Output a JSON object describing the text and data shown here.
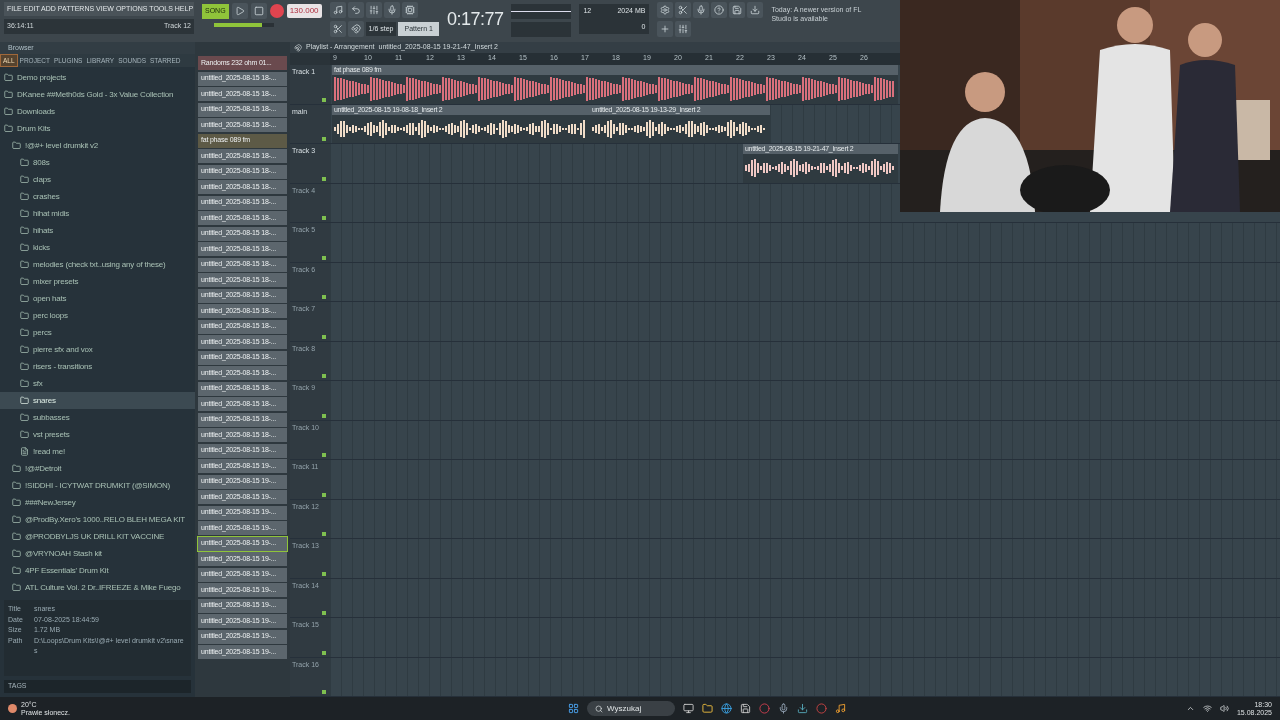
{
  "menu": "FILE EDIT ADD PATTERNS VIEW OPTIONS TOOLS HELP",
  "song_position": "36:14:11",
  "track_hint": "Track 12",
  "transport": {
    "mode": "SONG",
    "tempo": "130.000",
    "time": "0:17:77",
    "memory": "2024 MB",
    "cpu": "12",
    "polyphony": "0",
    "snap": "1/6 step",
    "pattern": "Pattern 1",
    "news": "Today: A newer version of FL Studio is available",
    "master_volume": {
      "level": 0.8
    }
  },
  "browser": {
    "title": "Browser",
    "tabs": [
      {
        "label": "ALL",
        "selected": true
      },
      {
        "label": "PROJECT",
        "selected": false
      },
      {
        "label": "PLUGINS",
        "selected": false
      },
      {
        "label": "LIBRARY",
        "selected": false
      },
      {
        "label": "SOUNDS",
        "selected": false
      },
      {
        "label": "STARRED",
        "selected": false
      }
    ],
    "tree": [
      {
        "label": "Demo projects",
        "kind": "folder",
        "selected": false
      },
      {
        "label": "DKanee ##Meth0ds Gold - 3x Value Collection",
        "kind": "folder",
        "selected": false
      },
      {
        "label": "Downloads",
        "kind": "folder",
        "selected": false
      },
      {
        "label": "Drum Kits",
        "kind": "folder",
        "selected": false,
        "children": [
          {
            "label": "!@#+ level drumkit v2",
            "kind": "folder",
            "selected": false,
            "children": [
              {
                "label": "808s",
                "kind": "folder",
                "selected": false
              },
              {
                "label": "claps",
                "kind": "folder",
                "selected": false
              },
              {
                "label": "crashes",
                "kind": "folder",
                "selected": false
              },
              {
                "label": "hihat midis",
                "kind": "folder",
                "selected": false
              },
              {
                "label": "hihats",
                "kind": "folder",
                "selected": false
              },
              {
                "label": "kicks",
                "kind": "folder",
                "selected": false
              },
              {
                "label": "melodies (check txt..using any of these)",
                "kind": "folder",
                "selected": false
              },
              {
                "label": "mixer presets",
                "kind": "folder",
                "selected": false
              },
              {
                "label": "open hats",
                "kind": "folder",
                "selected": false
              },
              {
                "label": "perc loops",
                "kind": "folder",
                "selected": false
              },
              {
                "label": "percs",
                "kind": "folder",
                "selected": false
              },
              {
                "label": "pierre sfx and vox",
                "kind": "folder",
                "selected": false
              },
              {
                "label": "risers - transitions",
                "kind": "folder",
                "selected": false
              },
              {
                "label": "sfx",
                "kind": "folder",
                "selected": false
              },
              {
                "label": "snares",
                "kind": "folder",
                "selected": true
              },
              {
                "label": "subbasses",
                "kind": "folder",
                "selected": false
              },
              {
                "label": "vst presets",
                "kind": "folder",
                "selected": false
              },
              {
                "label": "!read me!",
                "kind": "file",
                "selected": false
              }
            ]
          },
          {
            "label": "!@#Detroit",
            "kind": "folder",
            "selected": false
          },
          {
            "label": "!SIDDHI - ICYTWAT DRUMKIT (@SIMON)",
            "kind": "folder",
            "selected": false
          },
          {
            "label": "###NewJersey",
            "kind": "folder",
            "selected": false
          },
          {
            "label": "@ProdBy.Xero's 1000..RELO BLEH MEGA KIT",
            "kind": "folder",
            "selected": false
          },
          {
            "label": "@PRODBYLJS UK DRILL KIT VACCINE",
            "kind": "folder",
            "selected": false
          },
          {
            "label": "@VRYNOAH Stash kit",
            "kind": "folder",
            "selected": false
          },
          {
            "label": "4PF Essentials' Drum Kit",
            "kind": "folder",
            "selected": false
          },
          {
            "label": "ATL Culture Vol. 2 Dr..IFREEZE & Mike Fuego",
            "kind": "folder",
            "selected": false
          }
        ]
      }
    ],
    "info": [
      {
        "label": "Title",
        "value": "snares"
      },
      {
        "label": "Date",
        "value": "07-08-2025 18:44:59"
      },
      {
        "label": "Size",
        "value": "1.72 MB"
      },
      {
        "label": "Path",
        "value": "D:\\Loops\\Drum Kits\\!@#+ level drumkit v2\\snares"
      }
    ],
    "tags_label": "TAGS"
  },
  "channels": [
    {
      "label": "Randoms 232 ohm 01...",
      "selected": false,
      "color": "#6a4a4e"
    },
    {
      "label": "untitled_2025-08-15 18-...",
      "selected": false,
      "color": "#5c666d"
    },
    {
      "label": "untitled_2025-08-15 18-...",
      "selected": false,
      "color": "#5c666d"
    },
    {
      "label": "untitled_2025-08-15 18-...",
      "selected": false,
      "color": "#5c666d"
    },
    {
      "label": "untitled_2025-08-15 18-...",
      "selected": false,
      "color": "#5c666d"
    },
    {
      "label": "fat phase 089 fm",
      "selected": false,
      "color": "#5d5a46"
    },
    {
      "label": "untitled_2025-08-15 18-...",
      "selected": false,
      "color": "#5c666d"
    },
    {
      "label": "untitled_2025-08-15 18-...",
      "selected": false,
      "color": "#5c666d"
    },
    {
      "label": "untitled_2025-08-15 18-...",
      "selected": false,
      "color": "#5c666d"
    },
    {
      "label": "untitled_2025-08-15 18-...",
      "selected": false,
      "color": "#5c666d"
    },
    {
      "label": "untitled_2025-08-15 18-...",
      "selected": false,
      "color": "#5c666d"
    },
    {
      "label": "untitled_2025-08-15 18-...",
      "selected": false,
      "color": "#5c666d"
    },
    {
      "label": "untitled_2025-08-15 18-...",
      "selected": false,
      "color": "#5c666d"
    },
    {
      "label": "untitled_2025-08-15 18-...",
      "selected": false,
      "color": "#5c666d"
    },
    {
      "label": "untitled_2025-08-15 18-...",
      "selected": false,
      "color": "#5c666d"
    },
    {
      "label": "untitled_2025-08-15 18-...",
      "selected": false,
      "color": "#5c666d"
    },
    {
      "label": "untitled_2025-08-15 18-...",
      "selected": false,
      "color": "#5c666d"
    },
    {
      "label": "untitled_2025-08-15 18-...",
      "selected": false,
      "color": "#5c666d"
    },
    {
      "label": "untitled_2025-08-15 18-...",
      "selected": false,
      "color": "#5c666d"
    },
    {
      "label": "untitled_2025-08-15 18-...",
      "selected": false,
      "color": "#5c666d"
    },
    {
      "label": "untitled_2025-08-15 18-...",
      "selected": false,
      "color": "#5c666d"
    },
    {
      "label": "untitled_2025-08-15 18-...",
      "selected": false,
      "color": "#5c666d"
    },
    {
      "label": "untitled_2025-08-15 18-...",
      "selected": false,
      "color": "#5c666d"
    },
    {
      "label": "untitled_2025-08-15 18-...",
      "selected": false,
      "color": "#5c666d"
    },
    {
      "label": "untitled_2025-08-15 18-...",
      "selected": false,
      "color": "#5c666d"
    },
    {
      "label": "untitled_2025-08-15 18-...",
      "selected": false,
      "color": "#5c666d"
    },
    {
      "label": "untitled_2025-08-15 19-...",
      "selected": false,
      "color": "#5c666d"
    },
    {
      "label": "untitled_2025-08-15 19-...",
      "selected": false,
      "color": "#5c666d"
    },
    {
      "label": "untitled_2025-08-15 19-...",
      "selected": false,
      "color": "#5c666d"
    },
    {
      "label": "untitled_2025-08-15 19-...",
      "selected": false,
      "color": "#5c666d"
    },
    {
      "label": "untitled_2025-08-15 19-...",
      "selected": false,
      "color": "#5c666d"
    },
    {
      "label": "untitled_2025-08-15 19-...",
      "selected": true,
      "color": "#5c666d"
    },
    {
      "label": "untitled_2025-08-15 19-...",
      "selected": false,
      "color": "#5c666d"
    },
    {
      "label": "untitled_2025-08-15 19-...",
      "selected": false,
      "color": "#5c666d"
    },
    {
      "label": "untitled_2025-08-15 19-...",
      "selected": false,
      "color": "#5c666d"
    },
    {
      "label": "untitled_2025-08-15 19-...",
      "selected": false,
      "color": "#5c666d"
    },
    {
      "label": "untitled_2025-08-15 19-...",
      "selected": false,
      "color": "#5c666d"
    },
    {
      "label": "untitled_2025-08-15 19-...",
      "selected": false,
      "color": "#5c666d"
    },
    {
      "label": "untitled_2025-08-15 19-...",
      "selected": false,
      "color": "#5c666d"
    }
  ],
  "playlist": {
    "title": "Playlist - Arrangement",
    "pattern_name": "untitled_2025-08-15 19-21-47_Insert 2",
    "ruler": [
      "9",
      "10",
      "11",
      "12",
      "13",
      "14",
      "15",
      "16",
      "17",
      "18",
      "19",
      "20",
      "21",
      "22",
      "23",
      "24",
      "25",
      "26"
    ],
    "tracks": [
      {
        "name": "Track 1",
        "clips": [
          {
            "name": "fat phase 089 fm",
            "color": "#d9707c"
          }
        ]
      },
      {
        "name": "main",
        "clips": [
          {
            "name": "untitled_2025-08-15 19-08-18_Insert 2",
            "color": "#f0dcc8"
          },
          {
            "name": "untitled_2025-08-15 19-13-29_Insert 2",
            "color": "#f0dcc8"
          }
        ]
      },
      {
        "name": "Track 3",
        "clips": [
          {
            "name": "untitled_2025-08-15 19-21-47_Insert 2",
            "color": "#f0c8c4"
          }
        ]
      },
      {
        "name": "Track 4"
      },
      {
        "name": "Track 5"
      },
      {
        "name": "Track 6"
      },
      {
        "name": "Track 7"
      },
      {
        "name": "Track 8"
      },
      {
        "name": "Track 9"
      },
      {
        "name": "Track 10"
      },
      {
        "name": "Track 11"
      },
      {
        "name": "Track 12"
      },
      {
        "name": "Track 13"
      },
      {
        "name": "Track 14"
      },
      {
        "name": "Track 15"
      },
      {
        "name": "Track 16"
      }
    ]
  },
  "taskbar": {
    "weather_temp": "20°C",
    "weather_text": "Prawie słonecz.",
    "search": "Wyszukaj",
    "time": "18:30",
    "date": "15.08.2025"
  }
}
